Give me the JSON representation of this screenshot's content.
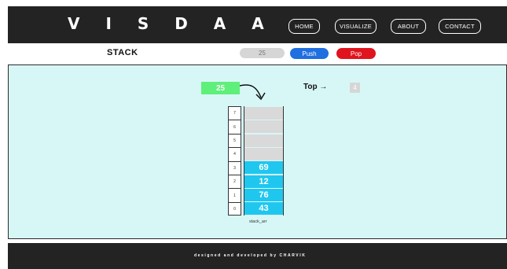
{
  "navbar": {
    "brand": "V I S D A A",
    "links": [
      "HOME",
      "VISUALIZE",
      "ABOUT",
      "CONTACT"
    ]
  },
  "controls": {
    "title": "STACK",
    "input_placeholder": "25",
    "push_label": "Push",
    "pop_label": "Pop"
  },
  "visualizer": {
    "pending_value": "25",
    "top_label": "Top →",
    "top_value": "4",
    "indices": [
      "7",
      "6",
      "5",
      "4",
      "3",
      "2",
      "1",
      "0"
    ],
    "slots": [
      "",
      "",
      "",
      "",
      "69",
      "12",
      "76",
      "43"
    ],
    "array_label": "stack_arr"
  },
  "footer": {
    "text": "designed and developed by CHARVIK"
  },
  "colors": {
    "navbar_bg": "#232323",
    "viz_bg": "#d7f7f7",
    "filled_cell": "#1fc7ef",
    "empty_cell": "#d9d9d9",
    "pending": "#5ef07a",
    "push": "#1f6fe0",
    "pop": "#e0141e"
  }
}
